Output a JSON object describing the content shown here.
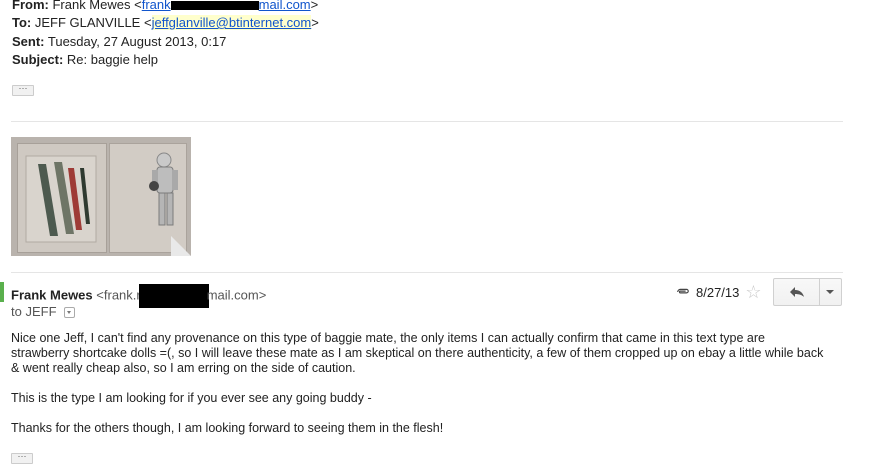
{
  "quoted_header": {
    "from_label": "From:",
    "from_name": "Frank Mewes",
    "from_email_start": "frank",
    "from_email_end": "mail.com",
    "to_label": "To:",
    "to_name": "JEFF GLANVILLE",
    "to_email": "jeffglanville@btinternet.com",
    "sent_label": "Sent:",
    "sent_value": "Tuesday, 27 August 2013, 0:17",
    "subject_label": "Subject:",
    "subject_value": "Re: baggie help",
    "ellipsis": "···"
  },
  "message": {
    "sender_name": "Frank Mewes",
    "sender_addr_start": "<frank.r",
    "sender_addr_end": "mail.com>",
    "to_line": "to JEFF",
    "date": "8/27/13",
    "icons": [
      "paperclip-icon",
      "star-icon",
      "reply-icon",
      "chevron-down-icon"
    ],
    "paragraphs": [
      "Nice one Jeff, I can't find any provenance on this type of baggie mate, the only items I can actually confirm that came in this text type are strawberry shortcake dolls =(, so I will leave these mate as I am skeptical on there authenticity, a few of them cropped up on ebay a little while back & went really cheap also, so I am erring on the side of caution.",
      "This is the type I am looking for if you ever see any going buddy -",
      "Thanks for the others though, I am looking forward to seeing them in the flesh!"
    ],
    "ellipsis": "···"
  },
  "colors": {
    "link": "#1155cc",
    "accent_bar": "#5ab04d",
    "highlight": "#ffffcc"
  }
}
